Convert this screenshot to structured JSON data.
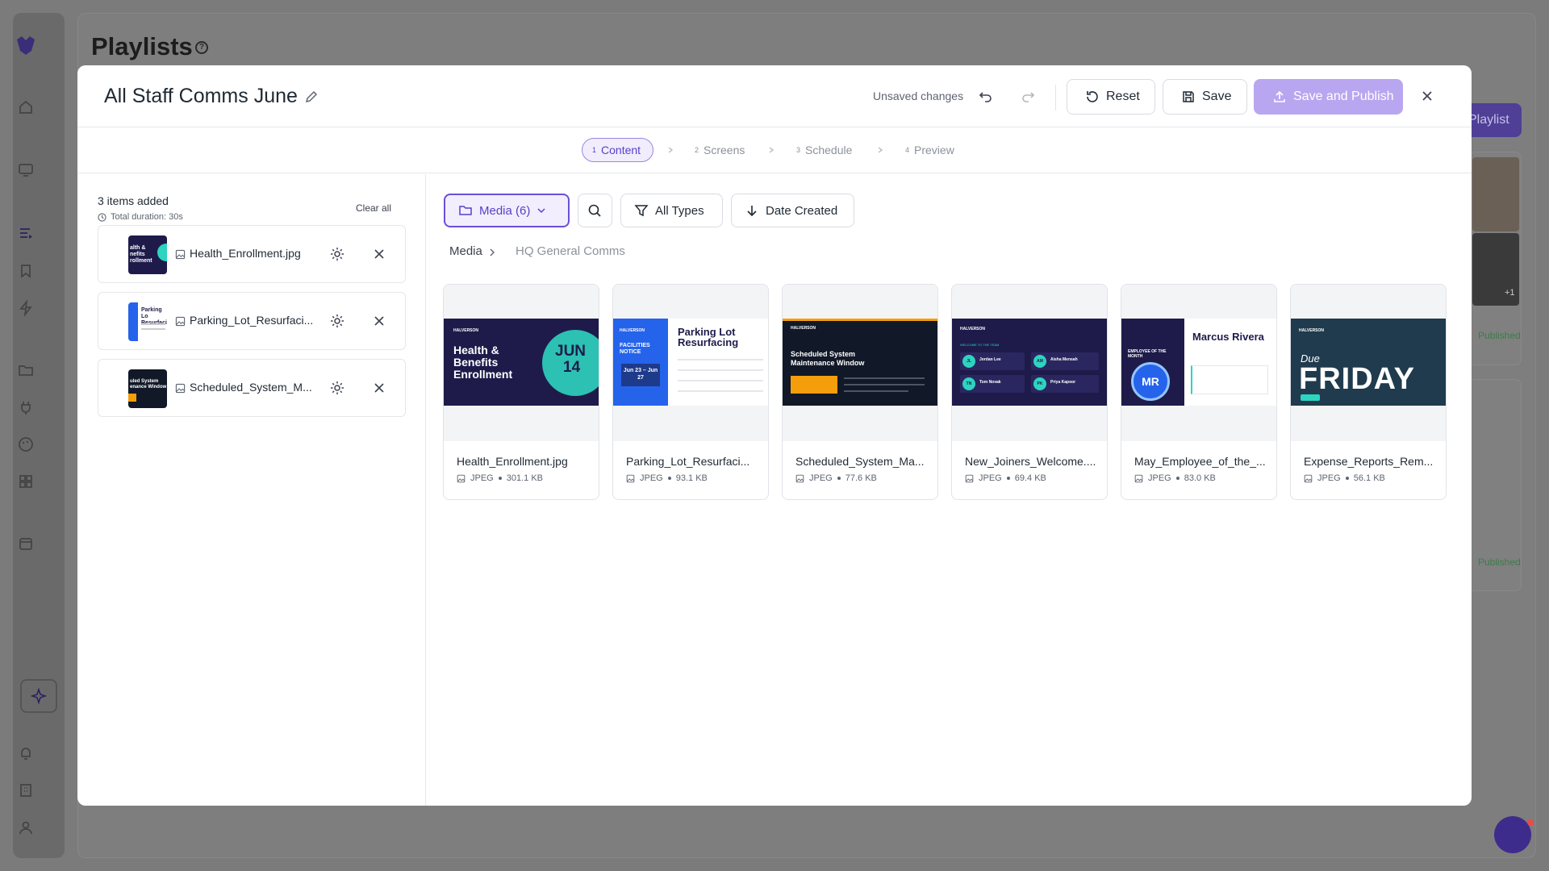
{
  "background": {
    "page_title": "Playlists",
    "help_icon": "?",
    "new_button_label": "Playlist",
    "published_label": "Published",
    "plus_count": "+1"
  },
  "sidebar": {
    "items": [
      {
        "icon": "logo-icon"
      },
      {
        "icon": "home-icon"
      },
      {
        "icon": "monitor-icon"
      },
      {
        "icon": "playlist-icon"
      },
      {
        "icon": "bookmark-icon"
      },
      {
        "icon": "bolt-icon"
      },
      {
        "icon": "folder-icon"
      },
      {
        "icon": "plug-icon"
      },
      {
        "icon": "palette-icon"
      },
      {
        "icon": "grid-icon"
      },
      {
        "icon": "calendar-icon"
      },
      {
        "icon": "sparkle-icon"
      },
      {
        "icon": "bell-icon"
      },
      {
        "icon": "building-icon"
      },
      {
        "icon": "user-icon"
      }
    ]
  },
  "modal": {
    "title": "All Staff Comms June",
    "unsaved": "Unsaved changes",
    "reset_label": "Reset",
    "save_label": "Save",
    "publish_label": "Save and Publish",
    "steps": [
      {
        "num": "1",
        "label": "Content"
      },
      {
        "num": "2",
        "label": "Screens"
      },
      {
        "num": "3",
        "label": "Schedule"
      },
      {
        "num": "4",
        "label": "Preview"
      }
    ]
  },
  "playlist": {
    "items_added": "3 items added",
    "duration": "Total duration: 30s",
    "clear_all": "Clear all",
    "items": [
      {
        "name": "Health_Enrollment.jpg"
      },
      {
        "name": "Parking_Lot_Resurfaci..."
      },
      {
        "name": "Scheduled_System_M..."
      }
    ]
  },
  "library": {
    "media_button": "Media (6)",
    "types_filter": "All Types",
    "sort_label": "Date Created",
    "breadcrumb": [
      "Media",
      "HQ General Comms"
    ],
    "cards": [
      {
        "name": "Health_Enrollment.jpg",
        "type": "JPEG",
        "size": "301.1 KB",
        "thumb": {
          "brand": "HALVERSON",
          "title": "Health & Benefits Enrollment",
          "month": "JUN",
          "day": "14"
        }
      },
      {
        "name": "Parking_Lot_Resurfaci...",
        "type": "JPEG",
        "size": "93.1 KB",
        "thumb": {
          "brand": "HALVERSON",
          "tag": "FACILITIES NOTICE",
          "title": "Parking Lot Resurfacing",
          "dates": "Jun 23 – Jun 27"
        }
      },
      {
        "name": "Scheduled_System_Ma...",
        "type": "JPEG",
        "size": "77.6 KB",
        "thumb": {
          "brand": "HALVERSON",
          "title": "Scheduled System Maintenance Window"
        }
      },
      {
        "name": "New_Joiners_Welcome....",
        "type": "JPEG",
        "size": "69.4 KB",
        "thumb": {
          "brand": "HALVERSON",
          "tag": "WELCOME TO THE TEAM",
          "people": [
            "Jordan Lee",
            "Aisha Mensah",
            "Tom Novak",
            "Priya Kapoor"
          ],
          "initials": [
            "JL",
            "AM",
            "TN",
            "PK"
          ]
        }
      },
      {
        "name": "May_Employee_of_the_...",
        "type": "JPEG",
        "size": "83.0 KB",
        "thumb": {
          "tag": "EMPLOYEE OF THE MONTH",
          "person": "Marcus Rivera",
          "initials": "MR"
        }
      },
      {
        "name": "Expense_Reports_Rem...",
        "type": "JPEG",
        "size": "56.1 KB",
        "thumb": {
          "brand": "HALVERSON",
          "sub": "Due",
          "title": "FRIDAY"
        }
      }
    ]
  },
  "colors": {
    "accent": "#6b4fd6",
    "publish": "#b9a6f0",
    "thumb_dark": "#1e1b4b",
    "thumb_teal": "#2dd4bf"
  }
}
